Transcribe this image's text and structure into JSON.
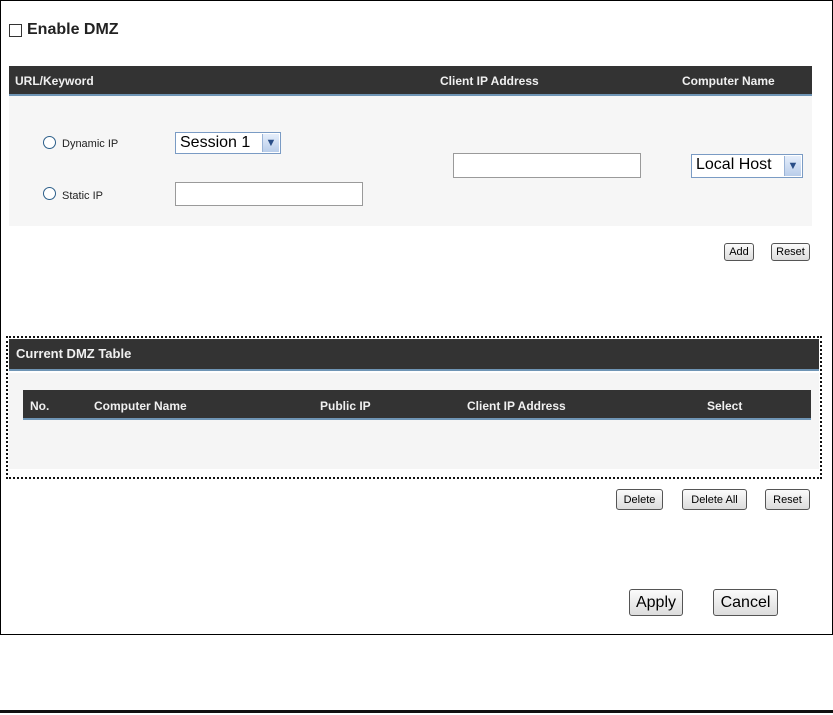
{
  "enable_dmz": {
    "label": "Enable DMZ",
    "checked": false
  },
  "entry_header": {
    "url_keyword": "URL/Keyword",
    "client_ip": "Client IP Address",
    "computer_name": "Computer Name"
  },
  "entry": {
    "dynamic_ip_label": "Dynamic IP",
    "session_select": "Session 1",
    "static_ip_label": "Static IP",
    "static_ip_value": "",
    "client_ip_value": "",
    "computer_select": "Local Host"
  },
  "entry_buttons": {
    "add": "Add",
    "reset": "Reset"
  },
  "dmz_table": {
    "title": "Current DMZ Table",
    "columns": [
      "No.",
      "Computer Name",
      "Public IP",
      "Client IP Address",
      "Select"
    ],
    "rows": []
  },
  "table_buttons": {
    "delete": "Delete",
    "delete_all": "Delete All",
    "reset": "Reset"
  },
  "footer_buttons": {
    "apply": "Apply",
    "cancel": "Cancel"
  },
  "colors": {
    "header_bg": "#333333",
    "header_accent": "#6f95b5",
    "panel_bg": "#f6f6f6"
  },
  "icons": {
    "select_arrow": "chevron-down-icon"
  }
}
